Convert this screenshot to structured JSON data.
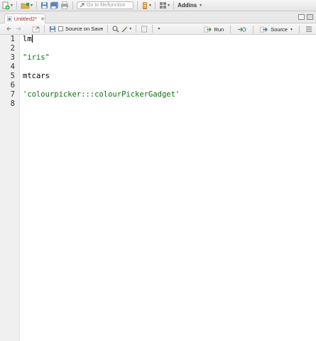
{
  "toolbar": {
    "goto_placeholder": "Go to file/function",
    "addins_label": "Addins"
  },
  "tab": {
    "title": "Untitled2*"
  },
  "editor_toolbar": {
    "source_on_save_label": "Source on Save",
    "run_label": "Run",
    "source_label": "Source"
  },
  "editor": {
    "line_numbers": [
      "1",
      "2",
      "3",
      "4",
      "5",
      "6",
      "7",
      "8"
    ],
    "lines": [
      {
        "text": "lm"
      },
      {
        "text": ""
      },
      {
        "text": "\"iris\""
      },
      {
        "text": ""
      },
      {
        "text": "mtcars"
      },
      {
        "text": ""
      },
      {
        "text": "'colourpicker:::colourPickerGadget'"
      },
      {
        "text": ""
      }
    ]
  },
  "colors": {
    "string": "#107010",
    "tab_title": "#b42d2d",
    "gutter_bg": "#f0f0f0"
  },
  "icons": [
    "new-file-icon",
    "open-project-icon",
    "save-icon",
    "save-all-icon",
    "print-icon",
    "goto-arrow-icon",
    "git-icon",
    "grid-icon",
    "back-arrow-icon",
    "forward-arrow-icon",
    "show-in-window-icon",
    "magnifier-icon",
    "wand-icon",
    "notebook-icon",
    "run-arrow-icon",
    "rerun-icon",
    "source-icon",
    "maximize-icon",
    "minimize-icon",
    "r-file-icon"
  ]
}
